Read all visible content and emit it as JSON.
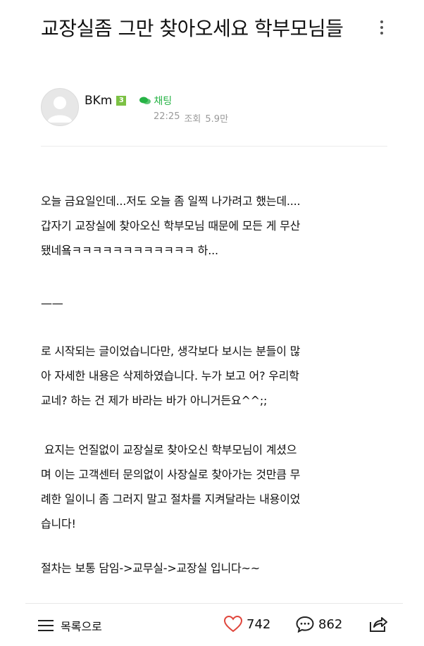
{
  "post": {
    "title": "교장실좀 그만 찾아오세요 학부모님들",
    "author": {
      "name": "BKm",
      "level": "3",
      "chat_label": "채팅"
    },
    "time": "22:25",
    "views_label": "조회",
    "views": "5.9만",
    "body": {
      "p1_line1": "오늘 금요일인데...저도 오늘 좀 일찍 나가려고 했는데....",
      "p1_line2": "갑자기 교장실에 찾아오신 학부모님 때문에 모든 게 무산",
      "p1_line3": "됐네욬ㅋㅋㅋㅋㅋㅋㅋㅋㅋㅋㅋㅋ 하...",
      "separator": "——",
      "p2_line1": "로 시작되는 글이었습니다만, 생각보다 보시는 분들이 많",
      "p2_line2": "아 자세한 내용은 삭제하였습니다. 누가 보고 어? 우리학",
      "p2_line3": "교네? 하는 건 제가 바라는 바가 아니거든요^^;;",
      "p3_line1": " 요지는 언질없이 교장실로 찾아오신 학부모님이 계셨으",
      "p3_line2": "며 이는 고객센터 문의없이 사장실로 찾아가는 것만큼 무",
      "p3_line3": "례한 일이니 좀 그러지 말고 절차를 지켜달라는 내용이었",
      "p3_line4": "습니다!",
      "p4_line1": "절차는 보통 담임->교무실->교장실 입니다~~"
    }
  },
  "bottom_bar": {
    "list_label": "목록으로",
    "likes": "742",
    "comments": "862"
  },
  "icons": {
    "more": "more-vertical-icon",
    "avatar": "default-avatar-icon",
    "chat": "chat-bubble-icon",
    "list": "menu-lines-icon",
    "like": "heart-icon",
    "comment": "comment-icon",
    "share": "share-icon"
  },
  "colors": {
    "chat_green": "#27b346",
    "level_badge": "#7cc144",
    "like_red": "#e0463c",
    "meta_gray": "#9a9a9a"
  }
}
